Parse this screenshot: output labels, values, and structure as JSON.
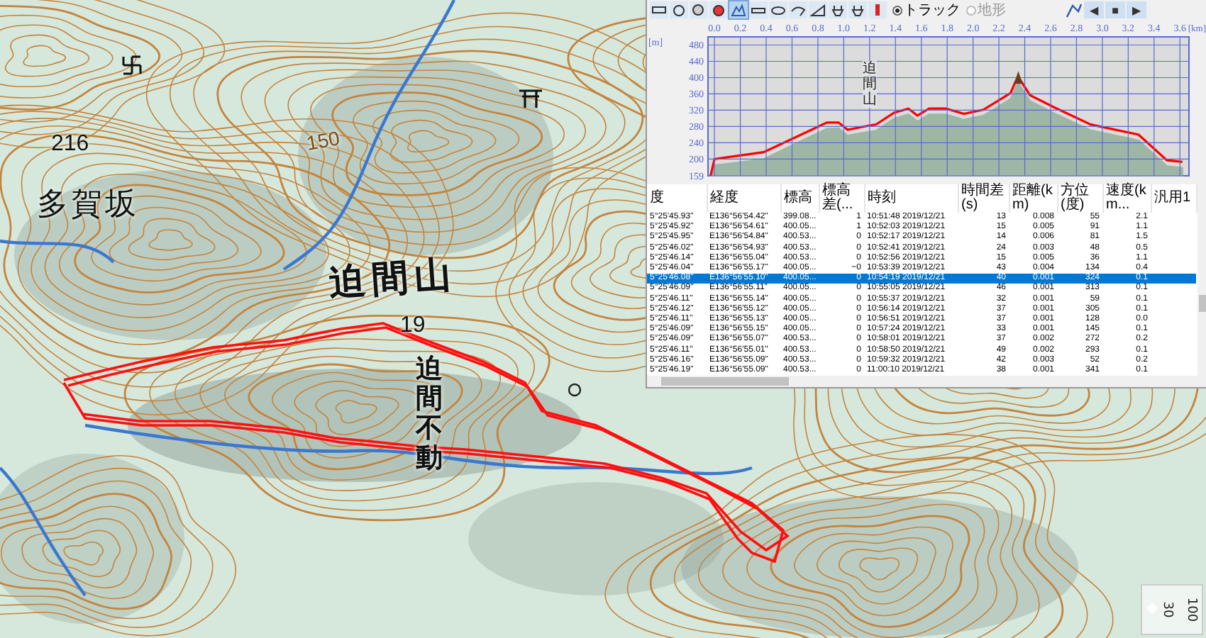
{
  "map": {
    "labels": [
      {
        "text": "216",
        "kind": "spot"
      },
      {
        "text": "150",
        "kind": "contour"
      },
      {
        "text": "多賀坂",
        "kind": "place"
      },
      {
        "text": "迫間山",
        "kind": "peak"
      },
      {
        "text": "19",
        "kind": "spot"
      },
      {
        "text": "迫間不動",
        "kind": "vertical"
      }
    ],
    "scale": {
      "labels": [
        "30",
        "100"
      ]
    }
  },
  "panel": {
    "toolbar": {
      "tools": [
        {
          "selected": false
        },
        {
          "selected": false
        },
        {
          "selected": false
        },
        {
          "selected": false
        },
        {
          "selected": true
        },
        {
          "selected": false
        },
        {
          "selected": false
        },
        {
          "selected": false
        },
        {
          "selected": false
        },
        {
          "selected": false
        },
        {
          "selected": false
        },
        {
          "selected": false
        }
      ],
      "radios": [
        {
          "label": "トラック",
          "selected": true,
          "disabled": false
        },
        {
          "label": "地形",
          "selected": false,
          "disabled": true
        }
      ],
      "nav": [
        "◀",
        "■",
        "▶"
      ]
    },
    "chart_data": {
      "type": "line",
      "xlabel": "[km]",
      "ylabel": "[m]",
      "xlim": [
        -0.05,
        3.67
      ],
      "ylim": [
        159,
        500
      ],
      "xticks": [
        {
          "value": 0,
          "label": "0.0"
        },
        {
          "value": 0.2,
          "label": "0.2"
        },
        {
          "value": 0.4,
          "label": "0.4"
        },
        {
          "value": 0.6,
          "label": "0.6"
        },
        {
          "value": 0.8,
          "label": "0.8"
        },
        {
          "value": 1.0,
          "label": "1.0"
        },
        {
          "value": 1.2,
          "label": "1.2"
        },
        {
          "value": 1.4,
          "label": "1.4"
        },
        {
          "value": 1.6,
          "label": "1.6"
        },
        {
          "value": 1.8,
          "label": "1.8"
        },
        {
          "value": 2.0,
          "label": "2.0"
        },
        {
          "value": 2.2,
          "label": "2.2"
        },
        {
          "value": 2.4,
          "label": "2.4"
        },
        {
          "value": 2.6,
          "label": "2.6"
        },
        {
          "value": 2.8,
          "label": "2.8"
        },
        {
          "value": 3.0,
          "label": "3.0"
        },
        {
          "value": 3.2,
          "label": "3.2"
        },
        {
          "value": 3.4,
          "label": "3.4"
        },
        {
          "value": 3.6,
          "label": "3.6"
        }
      ],
      "yticks": [
        159,
        200,
        240,
        280,
        320,
        360,
        400,
        440,
        480
      ],
      "x": [
        -0.03,
        0.0,
        0.38,
        0.67,
        0.87,
        0.96,
        1.03,
        1.18,
        1.25,
        1.39,
        1.5,
        1.57,
        1.66,
        1.79,
        1.93,
        2.08,
        2.29,
        2.33,
        2.35,
        2.44,
        2.62,
        2.91,
        3.28,
        3.5,
        3.62
      ],
      "grid": true,
      "series": [
        {
          "color": "#ff0000",
          "values": [
            159,
            200,
            217,
            260,
            290,
            290,
            272,
            281,
            285,
            314,
            324,
            307,
            324,
            324,
            311,
            321,
            362,
            391,
            402,
            357,
            328,
            285,
            260,
            197,
            193
          ]
        },
        {
          "color": "#9eb6a6",
          "type": "area",
          "values": [
            159,
            185,
            200,
            245,
            275,
            276,
            258,
            267,
            270,
            300,
            310,
            293,
            310,
            310,
            297,
            307,
            348,
            377,
            388,
            343,
            314,
            271,
            246,
            183,
            179
          ]
        }
      ],
      "annotations": [
        {
          "x": 1.2,
          "y": 380,
          "text": "迫間山"
        }
      ]
    },
    "table": {
      "columns": [
        "度",
        "経度",
        "標高",
        "標高差(...",
        "時刻",
        "時間差(s)",
        "距離(km)",
        "方位(度)",
        "速度(km...",
        "汎用1"
      ],
      "rows": [
        {
          "selected": false,
          "cells": [
            "5°25'45.93\"",
            "E136°56'54.42\"",
            "399.08...",
            "1",
            "10:51:48 2019/12/21",
            "13",
            "0.008",
            "55",
            "2.1"
          ]
        },
        {
          "selected": false,
          "cells": [
            "5°25'45.92\"",
            "E136°56'54.61\"",
            "400.05...",
            "1",
            "10:52:03 2019/12/21",
            "15",
            "0.005",
            "91",
            "1.1"
          ]
        },
        {
          "selected": false,
          "cells": [
            "5°25'45.95\"",
            "E136°56'54.84\"",
            "400.53...",
            "0",
            "10:52:17 2019/12/21",
            "14",
            "0.006",
            "81",
            "1.5"
          ]
        },
        {
          "selected": false,
          "cells": [
            "5°25'46.02\"",
            "E136°56'54.93\"",
            "400.53...",
            "0",
            "10:52:41 2019/12/21",
            "24",
            "0.003",
            "48",
            "0.5"
          ]
        },
        {
          "selected": false,
          "cells": [
            "5°25'46.14\"",
            "E136°56'55.04\"",
            "400.53...",
            "0",
            "10:52:56 2019/12/21",
            "15",
            "0.005",
            "36",
            "1.1"
          ]
        },
        {
          "selected": false,
          "cells": [
            "5°25'46.04\"",
            "E136°56'55.17\"",
            "400.05...",
            "−0",
            "10:53:39 2019/12/21",
            "43",
            "0.004",
            "134",
            "0.4"
          ]
        },
        {
          "selected": true,
          "cells": [
            "5°25'46.08\"",
            "E136°56'55.10\"",
            "400.05...",
            "0",
            "10:54:19 2019/12/21",
            "40",
            "0.001",
            "324",
            "0.1"
          ]
        },
        {
          "selected": false,
          "cells": [
            "5°25'46.09\"",
            "E136°56'55.11\"",
            "400.05...",
            "0",
            "10:55:05 2019/12/21",
            "46",
            "0.001",
            "313",
            "0.1"
          ]
        },
        {
          "selected": false,
          "cells": [
            "5°25'46.11\"",
            "E136°56'55.14\"",
            "400.05...",
            "0",
            "10:55:37 2019/12/21",
            "32",
            "0.001",
            "59",
            "0.1"
          ]
        },
        {
          "selected": false,
          "cells": [
            "5°25'46.12\"",
            "E136°56'55.12\"",
            "400.05...",
            "0",
            "10:56:14 2019/12/21",
            "37",
            "0.001",
            "305",
            "0.1"
          ]
        },
        {
          "selected": false,
          "cells": [
            "5°25'46.11\"",
            "E136°56'55.13\"",
            "400.05...",
            "0",
            "10:56:51 2019/12/21",
            "37",
            "0.001",
            "128",
            "0.0"
          ]
        },
        {
          "selected": false,
          "cells": [
            "5°25'46.09\"",
            "E136°56'55.15\"",
            "400.05...",
            "0",
            "10:57:24 2019/12/21",
            "33",
            "0.001",
            "145",
            "0.1"
          ]
        },
        {
          "selected": false,
          "cells": [
            "5°25'46.09\"",
            "E136°56'55.07\"",
            "400.53...",
            "0",
            "10:58:01 2019/12/21",
            "37",
            "0.002",
            "272",
            "0.2"
          ]
        },
        {
          "selected": false,
          "cells": [
            "5°25'46.11\"",
            "E136°56'55.01\"",
            "400.53...",
            "0",
            "10:58:50 2019/12/21",
            "49",
            "0.002",
            "293",
            "0.1"
          ]
        },
        {
          "selected": false,
          "cells": [
            "5°25'46.16\"",
            "E136°56'55.09\"",
            "400.53...",
            "0",
            "10:59:32 2019/12/21",
            "42",
            "0.003",
            "52",
            "0.2"
          ]
        },
        {
          "selected": false,
          "cells": [
            "5°25'46.19\"",
            "E136°56'55.09\"",
            "400.53...",
            "0",
            "11:00:10 2019/12/21",
            "38",
            "0.001",
            "341",
            "0.1"
          ]
        }
      ]
    }
  }
}
